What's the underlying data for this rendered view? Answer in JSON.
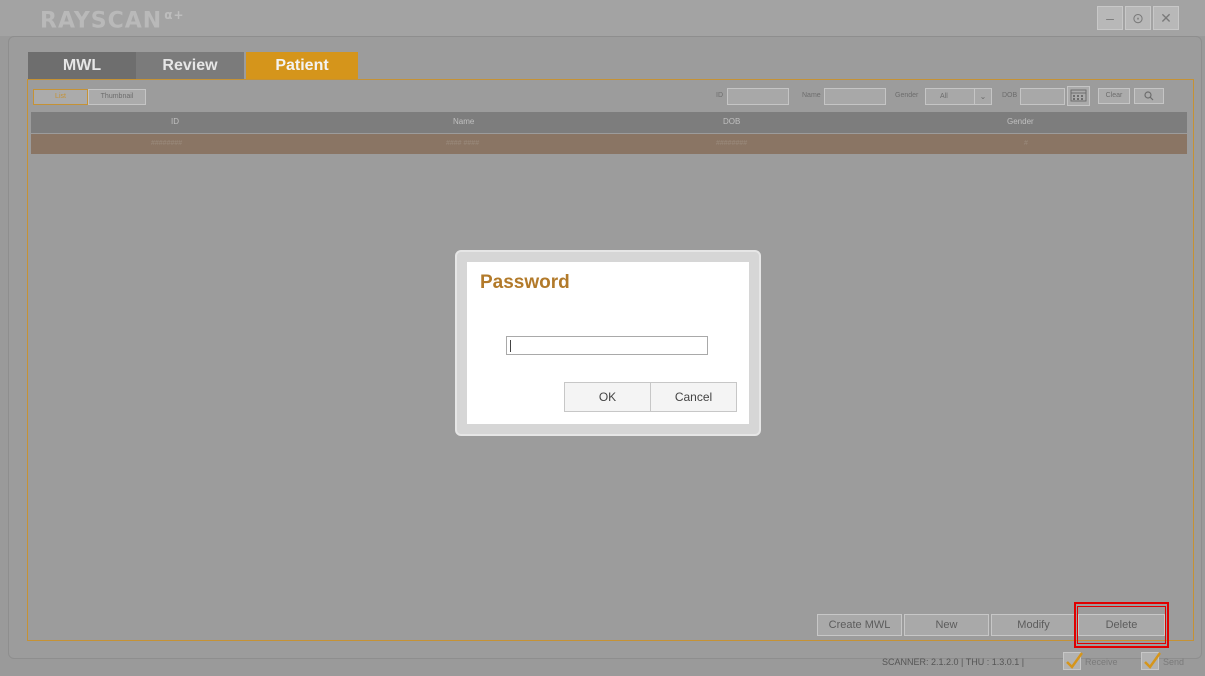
{
  "app": {
    "logo_text": "RAYSCAN",
    "logo_suffix": "α+",
    "window_controls": [
      "minimize-icon",
      "settings-icon",
      "close-icon"
    ]
  },
  "tabs": [
    {
      "label": "MWL",
      "active": false
    },
    {
      "label": "Review",
      "active": false
    },
    {
      "label": "Patient",
      "active": true
    }
  ],
  "toolbar": {
    "view_list": "List",
    "view_thumbnail": "Thumbnail",
    "filter_id_label": "ID",
    "filter_name_label": "Name",
    "filter_gender_label": "Gender",
    "filter_gender_value": "All",
    "filter_dob_label": "DOB",
    "clear_label": "Clear",
    "search_icon": "search-icon"
  },
  "table": {
    "columns": [
      "ID",
      "Name",
      "DOB",
      "Gender"
    ],
    "rows": [
      [
        "########",
        "#### ####",
        "########",
        "#"
      ]
    ]
  },
  "actions": {
    "create_mwl": "Create MWL",
    "new": "New",
    "modify": "Modify",
    "delete": "Delete"
  },
  "status": {
    "version": "SCANNER: 2.1.2.0 | THU : 1.3.0.1 |",
    "receive": "Receive",
    "send": "Send"
  },
  "dialog": {
    "title": "Password",
    "password_value": "",
    "ok": "OK",
    "cancel": "Cancel"
  },
  "colors": {
    "accent": "#d5951b",
    "highlight": "#e00000"
  }
}
